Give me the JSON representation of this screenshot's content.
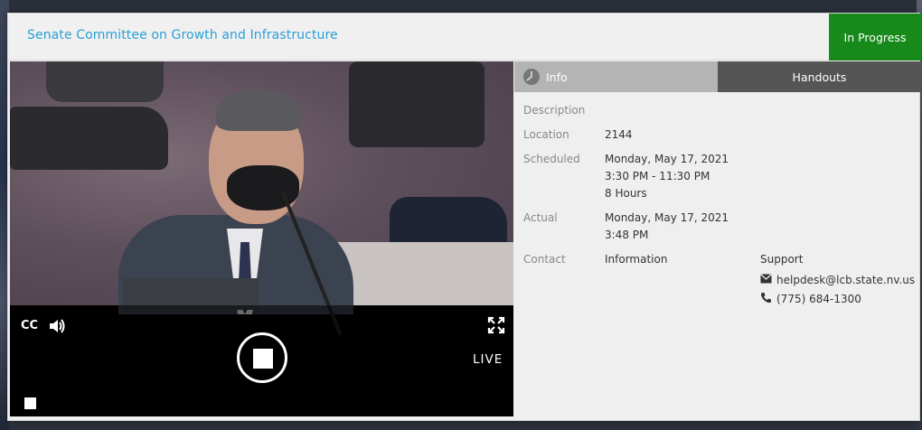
{
  "header": {
    "title": "Senate Committee on Growth and Infrastructure",
    "status": "In Progress",
    "status_color": "#178a1b",
    "title_color": "#2a9fd6"
  },
  "player": {
    "cc_label": "CC",
    "live_label": "LIVE",
    "icons": [
      "volume-icon",
      "fullscreen-icon",
      "stop-icon"
    ]
  },
  "tabs": {
    "info_label": "Info",
    "handouts_label": "Handouts",
    "info_icon": "clock-icon"
  },
  "details": {
    "description_label": "Description",
    "location_label": "Location",
    "location_value": "2144",
    "scheduled_label": "Scheduled",
    "scheduled_date": "Monday, May 17, 2021",
    "scheduled_time": "3:30 PM - 11:30 PM",
    "scheduled_duration": "8 Hours",
    "actual_label": "Actual",
    "actual_date": "Monday, May 17, 2021",
    "actual_time": "3:48 PM",
    "contact_label": "Contact",
    "contact_info": "Information",
    "support_label": "Support",
    "support_email": "helpdesk@lcb.state.nv.us",
    "support_phone": "(775) 684-1300"
  }
}
